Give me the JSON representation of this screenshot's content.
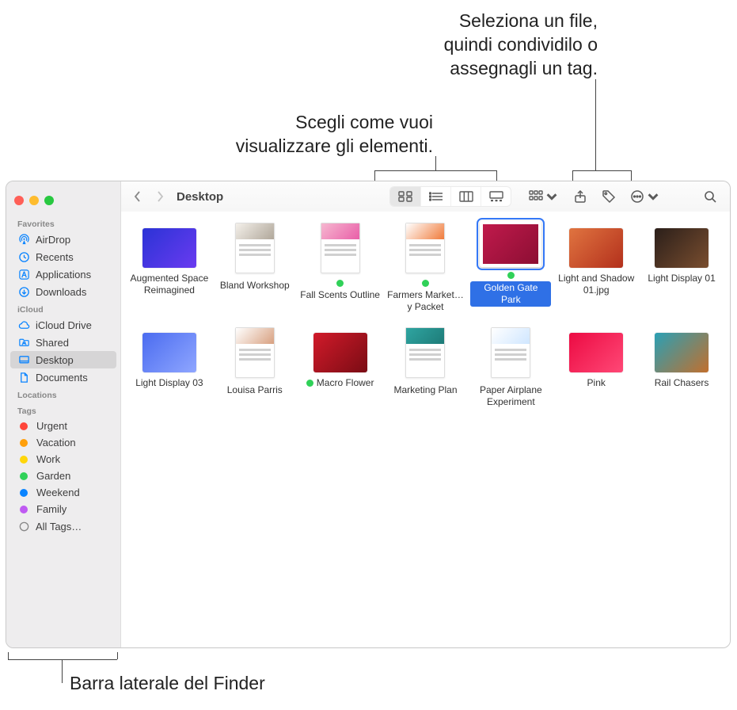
{
  "callouts": {
    "share": "Seleziona un file,\nquindi condividilo o\nassegnagli un tag.",
    "view": "Scegli come vuoi\nvisualizzare gli elementi.",
    "sidebar": "Barra laterale del Finder"
  },
  "window": {
    "title": "Desktop"
  },
  "sidebar": {
    "favorites_label": "Favorites",
    "favorites": [
      {
        "icon": "airdrop",
        "label": "AirDrop"
      },
      {
        "icon": "recents",
        "label": "Recents"
      },
      {
        "icon": "apps",
        "label": "Applications"
      },
      {
        "icon": "downloads",
        "label": "Downloads"
      }
    ],
    "icloud_label": "iCloud",
    "icloud": [
      {
        "icon": "icloud",
        "label": "iCloud Drive"
      },
      {
        "icon": "shared",
        "label": "Shared"
      },
      {
        "icon": "desktop",
        "label": "Desktop",
        "active": true
      },
      {
        "icon": "documents",
        "label": "Documents"
      }
    ],
    "locations_label": "Locations",
    "tags_label": "Tags",
    "tags": [
      {
        "color": "#ff453a",
        "label": "Urgent"
      },
      {
        "color": "#ff9f0a",
        "label": "Vacation"
      },
      {
        "color": "#ffd60a",
        "label": "Work"
      },
      {
        "color": "#30d158",
        "label": "Garden"
      },
      {
        "color": "#0a84ff",
        "label": "Weekend"
      },
      {
        "color": "#bf5af2",
        "label": "Family"
      }
    ],
    "all_tags_label": "All Tags…"
  },
  "files": [
    {
      "name": "Augmented Space Reimagined",
      "kind": "image",
      "colors": [
        "#2b33d6",
        "#6a3bf0"
      ],
      "tag": null,
      "selected": false
    },
    {
      "name": "Bland Workshop",
      "kind": "doc",
      "colors": [
        "#f4f0ea",
        "#b0a79a"
      ],
      "tag": null,
      "selected": false
    },
    {
      "name": "Fall Scents Outline",
      "kind": "doc",
      "colors": [
        "#f6b7d0",
        "#e95fa8"
      ],
      "tag": "#30d158",
      "selected": false
    },
    {
      "name": "Farmers Market…y Packet",
      "kind": "doc",
      "colors": [
        "#ffffff",
        "#f07b3b"
      ],
      "tag": "#30d158",
      "selected": false
    },
    {
      "name": "Golden Gate Park",
      "kind": "image",
      "colors": [
        "#c01a4c",
        "#8c0e33"
      ],
      "tag": "#30d158",
      "selected": true
    },
    {
      "name": "Light and Shadow 01.jpg",
      "kind": "image",
      "colors": [
        "#e07440",
        "#b3301c"
      ],
      "tag": null,
      "selected": false
    },
    {
      "name": "Light Display 01",
      "kind": "image",
      "colors": [
        "#2b1f1a",
        "#7a4e2f"
      ],
      "tag": null,
      "selected": false
    },
    {
      "name": "Light Display 03",
      "kind": "image",
      "colors": [
        "#4b6cf0",
        "#8fa6ff"
      ],
      "tag": null,
      "selected": false
    },
    {
      "name": "Louisa Parris",
      "kind": "doc",
      "colors": [
        "#ffffff",
        "#d8a080"
      ],
      "tag": null,
      "selected": false
    },
    {
      "name": "Macro Flower",
      "kind": "image",
      "colors": [
        "#d11a2a",
        "#7a0c14"
      ],
      "tag": "#30d158",
      "selected": false
    },
    {
      "name": "Marketing Plan",
      "kind": "doc",
      "colors": [
        "#2fa5a1",
        "#1e7b78"
      ],
      "tag": null,
      "selected": false
    },
    {
      "name": "Paper Airplane Experiment",
      "kind": "doc",
      "colors": [
        "#ffffff",
        "#cfe6ff"
      ],
      "tag": null,
      "selected": false
    },
    {
      "name": "Pink",
      "kind": "image",
      "colors": [
        "#ec0b43",
        "#ff4876"
      ],
      "tag": null,
      "selected": false
    },
    {
      "name": "Rail Chasers",
      "kind": "image",
      "colors": [
        "#2aa0b5",
        "#c26f2d"
      ],
      "tag": null,
      "selected": false
    }
  ]
}
